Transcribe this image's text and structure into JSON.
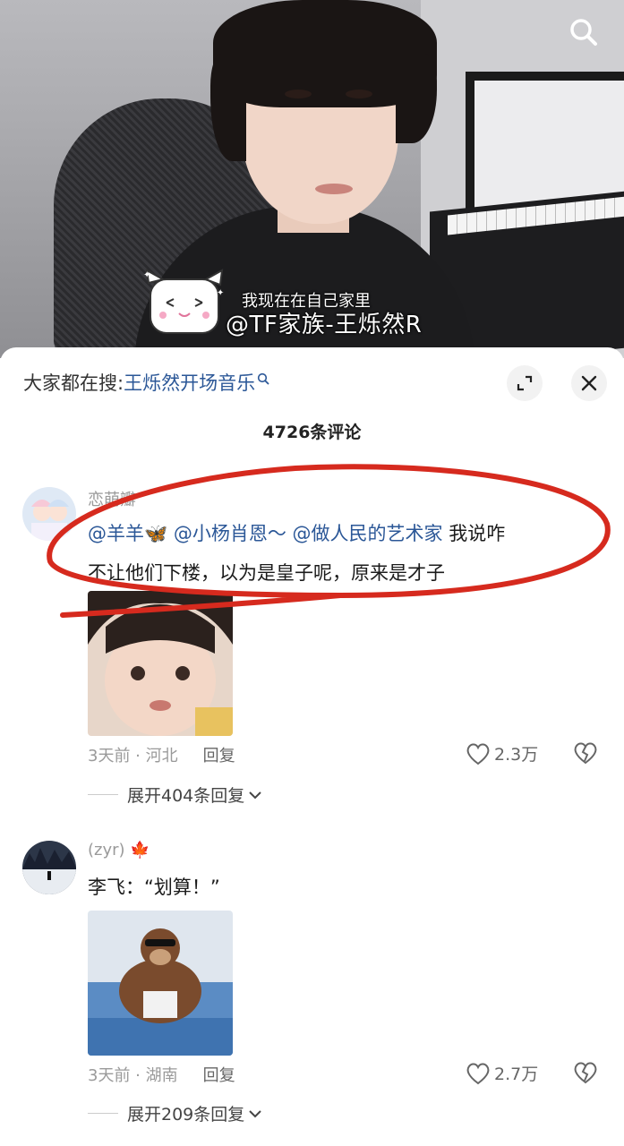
{
  "video": {
    "overlay_line1": "我现在在自己家里",
    "overlay_line2": "@TF家族-王烁然R",
    "search_icon": "search-icon"
  },
  "sheet": {
    "hot_search_prefix": "大家都在搜:",
    "hot_search_keyword": "王烁然开场音乐",
    "comment_count": "4726条评论"
  },
  "comments": [
    {
      "nickname": "恋萌瓣",
      "mentions": [
        "@羊羊",
        "@小杨肖恩～",
        "@做人民的艺术家"
      ],
      "text_part1": "我说咋",
      "text_part2": "不让他们下楼，以为是皇子呢，原来是才子",
      "time_location": "3天前 · 河北",
      "reply_label": "回复",
      "likes": "2.3万",
      "expand_label": "展开404条回复"
    },
    {
      "nickname": "(zyr)",
      "text": "李飞：“划算！”",
      "time_location": "3天前 · 湖南",
      "reply_label": "回复",
      "likes": "2.7万",
      "expand_label": "展开209条回复"
    }
  ],
  "colors": {
    "mention": "#2b5797",
    "annotation_red": "#d62a1e",
    "meta_gray": "#9a9a9a"
  }
}
